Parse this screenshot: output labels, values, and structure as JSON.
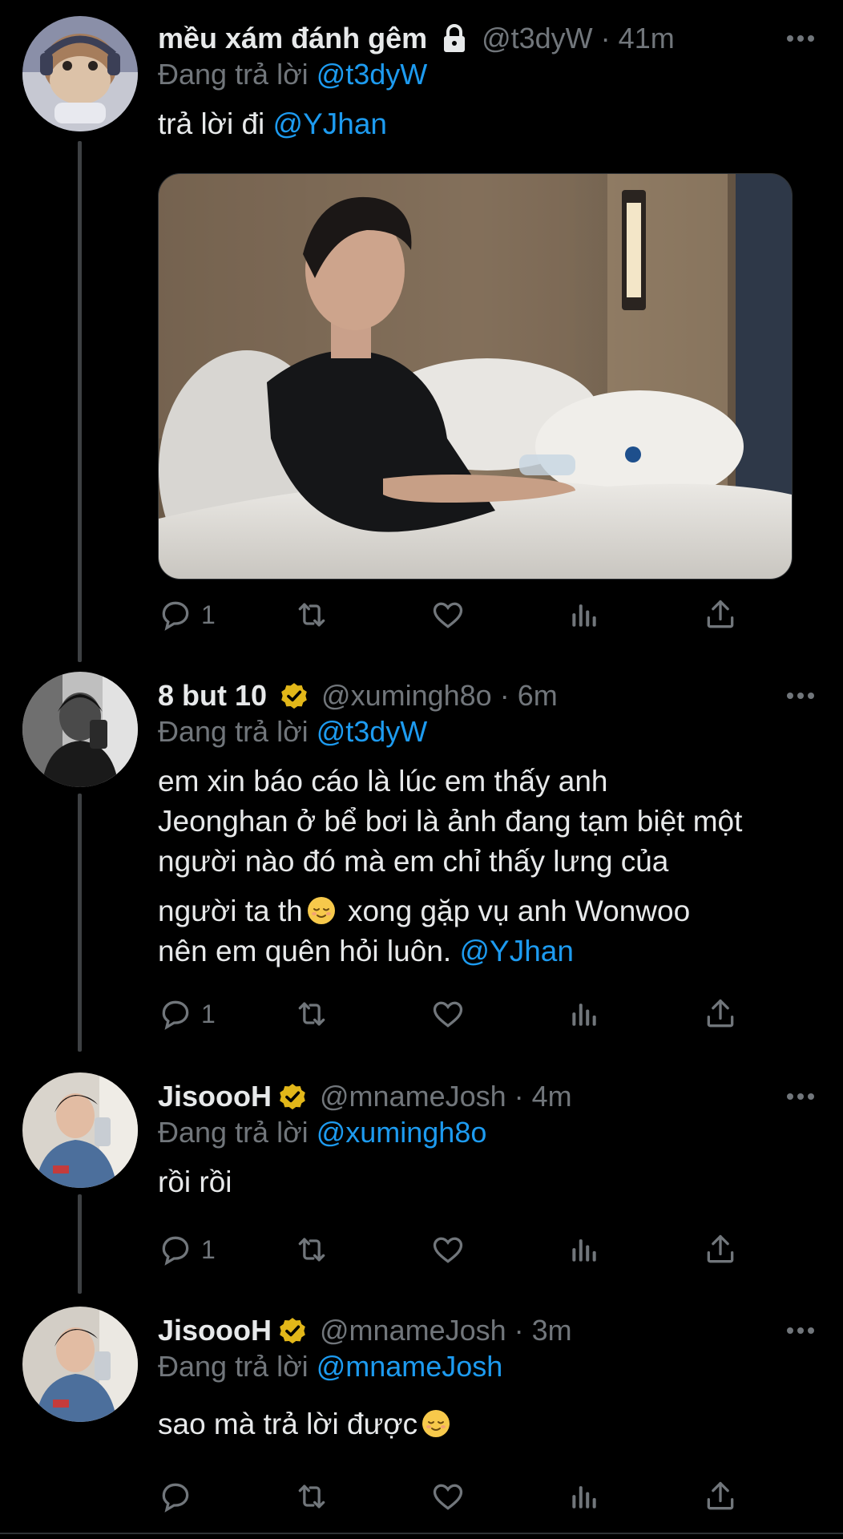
{
  "tweets": [
    {
      "name": "mều xám đánh gêm",
      "badge": "lock-icon",
      "handle": "@t3dyW",
      "separator": "·",
      "time": "41m",
      "reply_prefix": "Đang trả lời",
      "reply_to": "@t3dyW",
      "text": "trả lời đi",
      "mention": "@YJhan",
      "reply_count": "1",
      "has_photo": true
    },
    {
      "name": "8 but 10",
      "badge": "verified-gold-icon",
      "handle": "@xumingh8o",
      "separator": "·",
      "time": "6m",
      "reply_prefix": "Đang trả lời",
      "reply_to": "@t3dyW",
      "text_line1": "em xin báo cáo là lúc em thấy anh",
      "text_line2": "Jeonghan ở bể bơi là ảnh đang tạm biệt một",
      "text_line3": "người nào đó mà em chỉ thấy lưng của",
      "text_line4a": "người ta th",
      "text_line4b": " xong gặp vụ anh Wonwoo",
      "text_line5": "nên em quên hỏi luôn.",
      "mention": "@YJhan",
      "reply_count": "1"
    },
    {
      "name": "JisoooH",
      "badge": "verified-gold-icon",
      "handle": "@mnameJosh",
      "separator": "·",
      "time": "4m",
      "reply_prefix": "Đang trả lời",
      "reply_to": "@xumingh8o",
      "text": "rồi rồi",
      "reply_count": "1"
    },
    {
      "name": "JisoooH",
      "badge": "verified-gold-icon",
      "handle": "@mnameJosh",
      "separator": "·",
      "time": "3m",
      "reply_prefix": "Đang trả lời",
      "reply_to": "@mnameJosh",
      "text": "sao mà trả lời được",
      "reply_count": ""
    }
  ],
  "action_icons": [
    "reply-icon",
    "retweet-icon",
    "like-icon",
    "views-icon",
    "share-icon"
  ],
  "colors": {
    "background": "#000000",
    "text": "#e7e9ea",
    "secondary": "#71767b",
    "link": "#1d9bf0",
    "thread_line": "#3e4144",
    "verified_gold": "#e2b719"
  }
}
